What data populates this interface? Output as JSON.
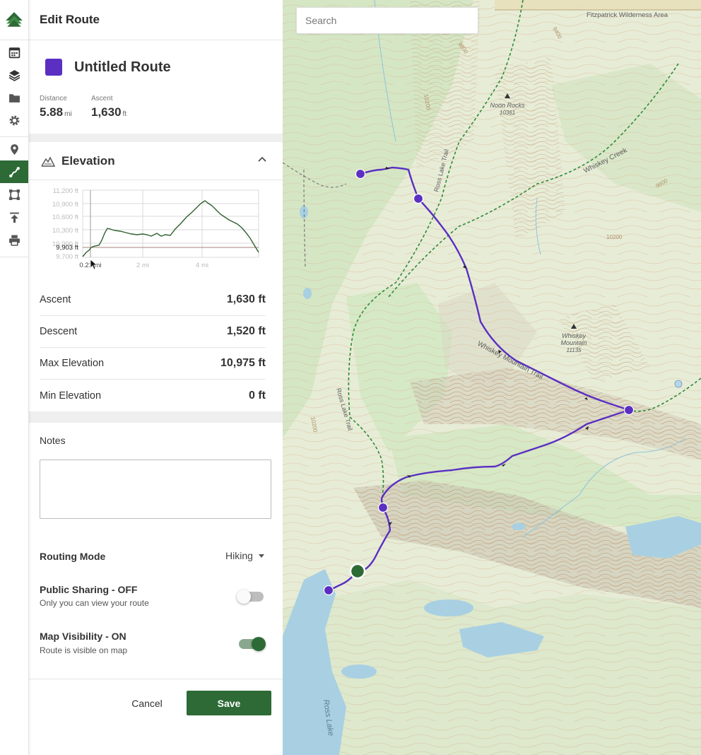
{
  "panel": {
    "header_title": "Edit Route",
    "route_name": "Untitled Route",
    "route_color": "#5a2fc2",
    "distance": {
      "label": "Distance",
      "value": "5.88",
      "unit": "mi"
    },
    "ascent_stat": {
      "label": "Ascent",
      "value": "1,630",
      "unit": "ft"
    }
  },
  "elevation": {
    "title": "Elevation",
    "y_ticks": [
      "11,200 ft",
      "10,900 ft",
      "10,600 ft",
      "10,300 ft",
      "10,000 ft",
      "9,700 ft"
    ],
    "x_ticks": [
      "2 mi",
      "4 mi"
    ],
    "cursor_x_label": "0.21 mi",
    "cursor_y_label": "9,903 ft",
    "metrics": [
      {
        "label": "Ascent",
        "value": "1,630 ft"
      },
      {
        "label": "Descent",
        "value": "1,520 ft"
      },
      {
        "label": "Max Elevation",
        "value": "10,975 ft"
      },
      {
        "label": "Min Elevation",
        "value": "0 ft"
      }
    ]
  },
  "notes": {
    "label": "Notes",
    "value": ""
  },
  "routing": {
    "label": "Routing Mode",
    "value": "Hiking"
  },
  "sharing": {
    "title": "Public Sharing - OFF",
    "subtitle": "Only you can view your route",
    "enabled": false
  },
  "visibility": {
    "title": "Map Visibility - ON",
    "subtitle": "Route is visible on map",
    "enabled": true
  },
  "buttons": {
    "cancel": "Cancel",
    "save": "Save"
  },
  "map": {
    "search_placeholder": "Search",
    "labels": {
      "fitzpatrick": "Fitzpatrick Wilderness Area",
      "noon_rocks": "Noon Rocks",
      "noon_rocks_elev": "10361",
      "whiskey_creek": "Whiskey Creek",
      "whiskey_mountain": "Whiskey",
      "whiskey_mountain_2": "Mountain",
      "whiskey_mountain_elev": "11135",
      "whiskey_trail": "Whiskey Mountain Trail",
      "ross_trail_north": "Ross Lake Trail",
      "ross_trail_south": "Ross Lake Trail",
      "ross_lake": "Ross Lake",
      "c9400": "9400",
      "c9800": "9800",
      "c10200a": "10200",
      "c9600": "9600",
      "c10200b": "10200",
      "c10200c": "10200"
    },
    "colors": {
      "route": "#5a2fc2",
      "trail": "#2d8a3a",
      "start": "#2d6a36"
    }
  }
}
